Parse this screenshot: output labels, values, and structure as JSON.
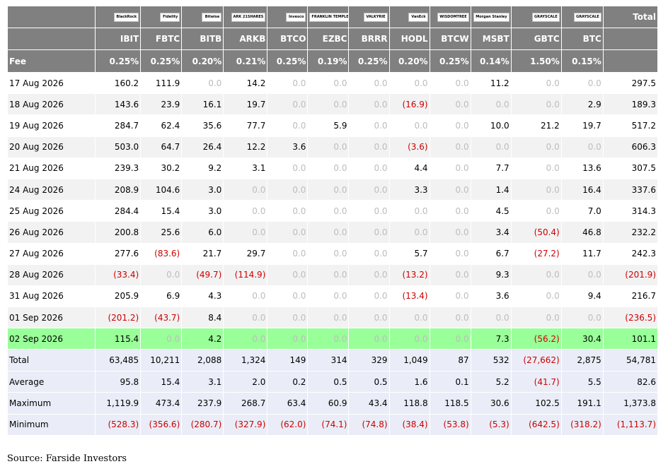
{
  "table": {
    "funds": [
      {
        "ticker": "IBIT",
        "fee": "0.25%",
        "logo": "BlackRock"
      },
      {
        "ticker": "FBTC",
        "fee": "0.25%",
        "logo": "Fidelity"
      },
      {
        "ticker": "BITB",
        "fee": "0.20%",
        "logo": "Bitwise"
      },
      {
        "ticker": "ARKB",
        "fee": "0.21%",
        "logo": "ARK 21SHARES"
      },
      {
        "ticker": "BTCO",
        "fee": "0.25%",
        "logo": "Invesco"
      },
      {
        "ticker": "EZBC",
        "fee": "0.19%",
        "logo": "FRANKLIN TEMPLETON"
      },
      {
        "ticker": "BRRR",
        "fee": "0.25%",
        "logo": "VALKYRIE"
      },
      {
        "ticker": "HODL",
        "fee": "0.20%",
        "logo": "VanEck"
      },
      {
        "ticker": "BTCW",
        "fee": "0.25%",
        "logo": "WISDOMTREE"
      },
      {
        "ticker": "MSBT",
        "fee": "0.14%",
        "logo": "Morgan Stanley"
      },
      {
        "ticker": "GBTC",
        "fee": "1.50%",
        "logo": "GRAYSCALE"
      },
      {
        "ticker": "BTC",
        "fee": "0.15%",
        "logo": "GRAYSCALE"
      }
    ],
    "total_header": "Total",
    "fee_label": "Fee",
    "rows": [
      {
        "date": "17 Aug 2026",
        "values": [
          "160.2",
          "111.9",
          "0.0",
          "14.2",
          "0.0",
          "0.0",
          "0.0",
          "0.0",
          "0.0",
          "11.2",
          "0.0",
          "0.0"
        ],
        "total": "297.5"
      },
      {
        "date": "18 Aug 2026",
        "values": [
          "143.6",
          "23.9",
          "16.1",
          "19.7",
          "0.0",
          "0.0",
          "0.0",
          "(16.9)",
          "0.0",
          "0.0",
          "0.0",
          "2.9"
        ],
        "total": "189.3"
      },
      {
        "date": "19 Aug 2026",
        "values": [
          "284.7",
          "62.4",
          "35.6",
          "77.7",
          "0.0",
          "5.9",
          "0.0",
          "0.0",
          "0.0",
          "10.0",
          "21.2",
          "19.7"
        ],
        "total": "517.2"
      },
      {
        "date": "20 Aug 2026",
        "values": [
          "503.0",
          "64.7",
          "26.4",
          "12.2",
          "3.6",
          "0.0",
          "0.0",
          "(3.6)",
          "0.0",
          "0.0",
          "0.0",
          "0.0"
        ],
        "total": "606.3"
      },
      {
        "date": "21 Aug 2026",
        "values": [
          "239.3",
          "30.2",
          "9.2",
          "3.1",
          "0.0",
          "0.0",
          "0.0",
          "4.4",
          "0.0",
          "7.7",
          "0.0",
          "13.6"
        ],
        "total": "307.5"
      },
      {
        "date": "24 Aug 2026",
        "values": [
          "208.9",
          "104.6",
          "3.0",
          "0.0",
          "0.0",
          "0.0",
          "0.0",
          "3.3",
          "0.0",
          "1.4",
          "0.0",
          "16.4"
        ],
        "total": "337.6"
      },
      {
        "date": "25 Aug 2026",
        "values": [
          "284.4",
          "15.4",
          "3.0",
          "0.0",
          "0.0",
          "0.0",
          "0.0",
          "0.0",
          "0.0",
          "4.5",
          "0.0",
          "7.0"
        ],
        "total": "314.3"
      },
      {
        "date": "26 Aug 2026",
        "values": [
          "200.8",
          "25.6",
          "6.0",
          "0.0",
          "0.0",
          "0.0",
          "0.0",
          "0.0",
          "0.0",
          "3.4",
          "(50.4)",
          "46.8"
        ],
        "total": "232.2"
      },
      {
        "date": "27 Aug 2026",
        "values": [
          "277.6",
          "(83.6)",
          "21.7",
          "29.7",
          "0.0",
          "0.0",
          "0.0",
          "5.7",
          "0.0",
          "6.7",
          "(27.2)",
          "11.7"
        ],
        "total": "242.3"
      },
      {
        "date": "28 Aug 2026",
        "values": [
          "(33.4)",
          "0.0",
          "(49.7)",
          "(114.9)",
          "0.0",
          "0.0",
          "0.0",
          "(13.2)",
          "0.0",
          "9.3",
          "0.0",
          "0.0"
        ],
        "total": "(201.9)"
      },
      {
        "date": "31 Aug 2026",
        "values": [
          "205.9",
          "6.9",
          "4.3",
          "0.0",
          "0.0",
          "0.0",
          "0.0",
          "(13.4)",
          "0.0",
          "3.6",
          "0.0",
          "9.4"
        ],
        "total": "216.7"
      },
      {
        "date": "01 Sep 2026",
        "values": [
          "(201.2)",
          "(43.7)",
          "8.4",
          "0.0",
          "0.0",
          "0.0",
          "0.0",
          "0.0",
          "0.0",
          "0.0",
          "0.0",
          "0.0"
        ],
        "total": "(236.5)"
      },
      {
        "date": "02 Sep 2026",
        "values": [
          "115.4",
          "0.0",
          "4.2",
          "0.0",
          "0.0",
          "0.0",
          "0.0",
          "0.0",
          "0.0",
          "7.3",
          "(56.2)",
          "30.4"
        ],
        "total": "101.1",
        "highlight": true
      }
    ],
    "summary": [
      {
        "label": "Total",
        "values": [
          "63,485",
          "10,211",
          "2,088",
          "1,324",
          "149",
          "314",
          "329",
          "1,049",
          "87",
          "532",
          "(27,662)",
          "2,875"
        ],
        "total": "54,781"
      },
      {
        "label": "Average",
        "values": [
          "95.8",
          "15.4",
          "3.1",
          "2.0",
          "0.2",
          "0.5",
          "0.5",
          "1.6",
          "0.1",
          "5.2",
          "(41.7)",
          "5.5"
        ],
        "total": "82.6"
      },
      {
        "label": "Maximum",
        "values": [
          "1,119.9",
          "473.4",
          "237.9",
          "268.7",
          "63.4",
          "60.9",
          "43.4",
          "118.8",
          "118.5",
          "30.6",
          "102.5",
          "191.1"
        ],
        "total": "1,373.8"
      },
      {
        "label": "Minimum",
        "values": [
          "(528.3)",
          "(356.6)",
          "(280.7)",
          "(327.9)",
          "(62.0)",
          "(74.1)",
          "(74.8)",
          "(38.4)",
          "(53.8)",
          "(5.3)",
          "(642.5)",
          "(318.2)"
        ],
        "total": "(1,113.7)"
      }
    ]
  },
  "source": "Source: Farside Investors",
  "colors": {
    "header_bg": "#808080",
    "alt_row_bg": "#f2f2f2",
    "highlight_row_bg": "#99ff99",
    "summary_bg": "#eaedf7",
    "negative_text": "#cc0000",
    "zero_text": "#bdbdbd"
  }
}
